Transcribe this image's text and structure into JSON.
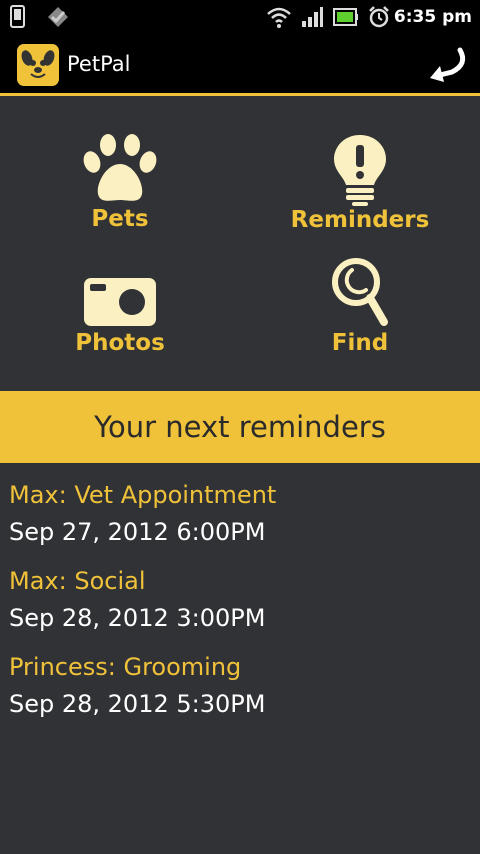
{
  "status_bar": {
    "time": "6:35 pm"
  },
  "app": {
    "title": "PetPal"
  },
  "dashboard": {
    "items": [
      {
        "label": "Pets",
        "icon": "paw-icon"
      },
      {
        "label": "Reminders",
        "icon": "lightbulb-icon"
      },
      {
        "label": "Photos",
        "icon": "camera-icon"
      },
      {
        "label": "Find",
        "icon": "search-icon"
      }
    ]
  },
  "reminders": {
    "header": "Your next reminders",
    "items": [
      {
        "title": "Max: Vet Appointment",
        "date": "Sep 27, 2012 6:00PM"
      },
      {
        "title": "Max: Social",
        "date": "Sep 28, 2012 3:00PM"
      },
      {
        "title": "Princess: Grooming",
        "date": "Sep 28, 2012 5:30PM"
      }
    ]
  },
  "colors": {
    "accent": "#f0c23a",
    "background": "#303236",
    "bar": "#000000",
    "icon": "#fbf0c2"
  }
}
